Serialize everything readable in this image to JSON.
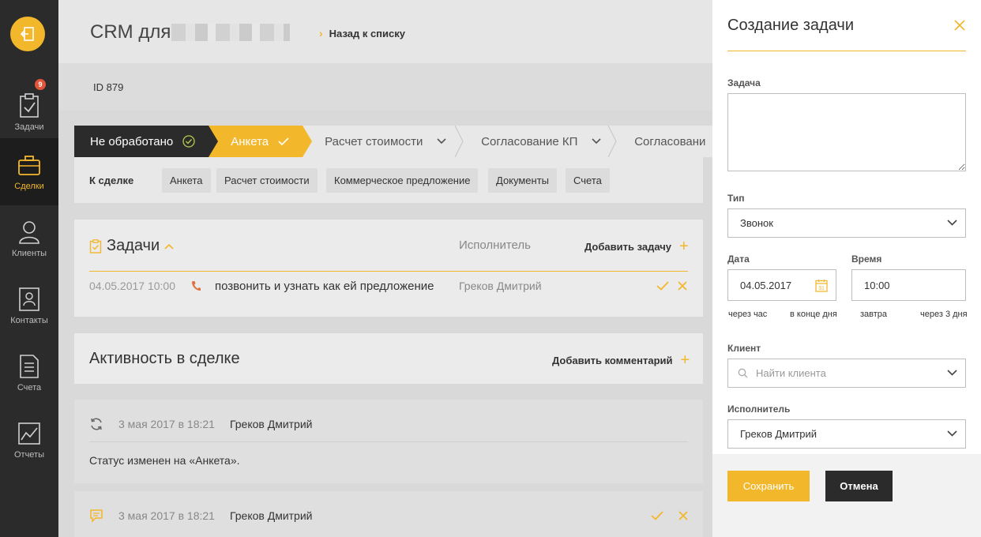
{
  "sidebar": {
    "badge_count": "9",
    "items": [
      {
        "label": "Задачи"
      },
      {
        "label": "Сделки"
      },
      {
        "label": "Клиенты"
      },
      {
        "label": "Контакты"
      },
      {
        "label": "Счета"
      },
      {
        "label": "Отчеты"
      }
    ]
  },
  "header": {
    "app_title": "CRM для",
    "back_label": "Назад к списку",
    "deal_id": "ID 879"
  },
  "stages": [
    {
      "label": "Не обработано"
    },
    {
      "label": "Анкета"
    },
    {
      "label": "Расчет стоимости"
    },
    {
      "label": "Согласование КП"
    },
    {
      "label": "Согласовани"
    }
  ],
  "deal_links": {
    "label": "К сделке",
    "chips": [
      "Анкета",
      "Расчет стоимости",
      "Коммерческое предложение",
      "Документы",
      "Счета"
    ]
  },
  "tasks": {
    "title": "Задачи",
    "assignee_header": "Исполнитель",
    "add_label": "Добавить задачу",
    "rows": [
      {
        "date": "04.05.2017 10:00",
        "text": "позвонить и узнать как ей предложение",
        "assignee": "Греков Дмитрий"
      }
    ]
  },
  "activity": {
    "title": "Активность в сделке",
    "add_label": "Добавить комментарий",
    "items": [
      {
        "date": "3 мая 2017 в 18:21",
        "author": "Греков Дмитрий",
        "body": "Статус изменен на «Анкета»."
      },
      {
        "date": "3 мая 2017 в 18:21",
        "author": "Греков Дмитрий"
      }
    ]
  },
  "create_task": {
    "title": "Создание задачи",
    "task_label": "Задача",
    "task_value": "",
    "type_label": "Тип",
    "type_value": "Звонок",
    "date_label": "Дата",
    "date_value": "04.05.2017",
    "time_label": "Время",
    "time_value": "10:00",
    "quick_dates": [
      "через час",
      "в конце дня",
      "завтра",
      "через 3 дня"
    ],
    "client_label": "Клиент",
    "client_placeholder": "Найти клиента",
    "assignee_label": "Исполнитель",
    "assignee_value": "Греков Дмитрий",
    "save_label": "Сохранить",
    "cancel_label": "Отмена"
  },
  "colors": {
    "accent": "#f3b72b",
    "sidebar_bg": "#2b2b2b",
    "badge": "#e2553a"
  }
}
